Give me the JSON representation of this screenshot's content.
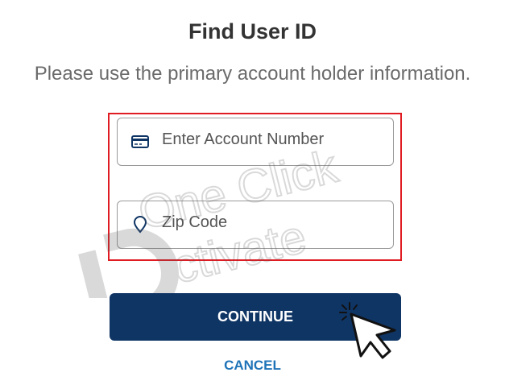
{
  "header": {
    "title": "Find User ID",
    "subtitle": "Please use the primary account holder information."
  },
  "form": {
    "account_placeholder": "Enter Account Number",
    "account_icon": "card-icon",
    "zip_placeholder": "Zip Code",
    "zip_icon": "location-pin-icon",
    "highlight_color": "#e01b22"
  },
  "actions": {
    "continue_label": "CONTINUE",
    "cancel_label": "CANCEL",
    "primary_color": "#0f3565",
    "link_color": "#1e73b8"
  },
  "watermark": {
    "line1": "One Click",
    "line2": "ctivate"
  }
}
